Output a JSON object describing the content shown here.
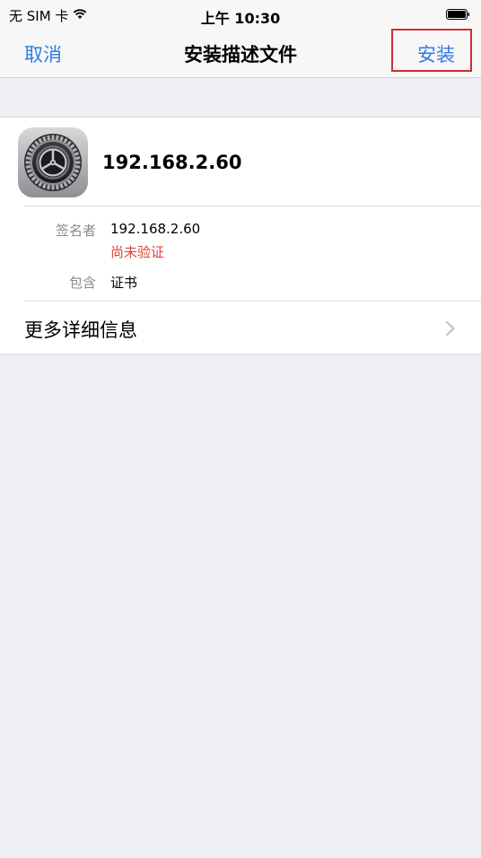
{
  "status_bar": {
    "carrier": "无 SIM 卡",
    "time": "上午 10:30",
    "icons": [
      "wifi-icon",
      "battery-icon"
    ]
  },
  "nav": {
    "cancel_label": "取消",
    "title": "安装描述文件",
    "install_label": "安装",
    "highlight_color": "#d22c2c",
    "accent_color": "#2f7be6"
  },
  "profile": {
    "name": "192.168.2.60",
    "icon": "settings-gear-icon",
    "details": {
      "signer_label": "签名者",
      "signer_value": "192.168.2.60",
      "signer_status": "尚未验证",
      "contains_label": "包含",
      "contains_value": "证书"
    },
    "more_details_label": "更多详细信息"
  },
  "colors": {
    "warning": "#e0423a",
    "background": "#efeff4"
  }
}
